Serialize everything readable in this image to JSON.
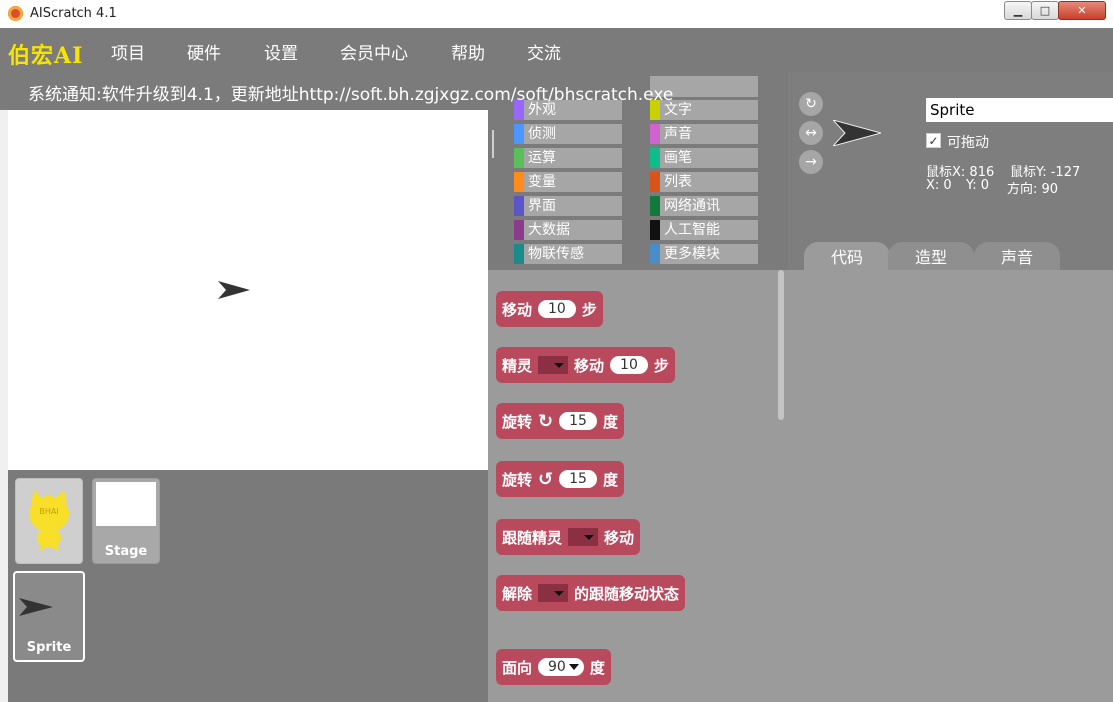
{
  "window": {
    "title": "AIScratch 4.1",
    "minimize": "▁",
    "maximize": "□",
    "close": "✕"
  },
  "menu": {
    "logo": "伯宏AI",
    "items": [
      "项目",
      "硬件",
      "设置",
      "会员中心",
      "帮助",
      "交流"
    ]
  },
  "notice": "系统通知:软件升级到4.1，更新地址http://soft.bh.zgjxgz.com/soft/bhscratch.exe",
  "categories": {
    "left": [
      {
        "label": "外观",
        "color": "#9966ff"
      },
      {
        "label": "侦测",
        "color": "#4c97ff"
      },
      {
        "label": "运算",
        "color": "#59c059"
      },
      {
        "label": "变量",
        "color": "#ff8c1a"
      },
      {
        "label": "界面",
        "color": "#5b55c8"
      },
      {
        "label": "大数据",
        "color": "#8c3a8c"
      },
      {
        "label": "物联传感",
        "color": "#1a8a8a"
      }
    ],
    "right": [
      {
        "label": "文字",
        "color": "#c8d200"
      },
      {
        "label": "声音",
        "color": "#cf63cf"
      },
      {
        "label": "画笔",
        "color": "#0fbd8c"
      },
      {
        "label": "列表",
        "color": "#d9541a"
      },
      {
        "label": "网络通讯",
        "color": "#0f7a3c"
      },
      {
        "label": "人工智能",
        "color": "#111111"
      },
      {
        "label": "更多模块",
        "color": "#4a8cc8"
      }
    ]
  },
  "blocks": {
    "move": {
      "label": "移动",
      "value": "10",
      "unit": "步"
    },
    "sprite_move": {
      "label": "精灵",
      "label2": "移动",
      "value": "10",
      "unit": "步"
    },
    "turn_right": {
      "label": "旋转",
      "icon": "↻",
      "value": "15",
      "unit": "度"
    },
    "turn_left": {
      "label": "旋转",
      "icon": "↺",
      "value": "15",
      "unit": "度"
    },
    "follow": {
      "label": "跟随精灵",
      "label2": "移动"
    },
    "unfollow": {
      "label": "解除",
      "label2": "的跟随移动状态"
    },
    "face": {
      "label": "面向",
      "value": "90",
      "unit": "度"
    }
  },
  "sprites": {
    "cat_badge": "BHAI",
    "stage_label": "Stage",
    "sprite_label": "Sprite"
  },
  "info": {
    "name": "Sprite",
    "draggable_label": "可拖动",
    "draggable_check": "✓",
    "mouse_x": "鼠标X: 816",
    "mouse_y": "鼠标Y: -127",
    "x": "X: 0",
    "y": "Y: 0",
    "direction": "方向: 90",
    "rotate_all": "↻",
    "rotate_lr": "↔",
    "rotate_none": "→"
  },
  "tabs": {
    "code": "代码",
    "costume": "造型",
    "sound": "声音"
  }
}
